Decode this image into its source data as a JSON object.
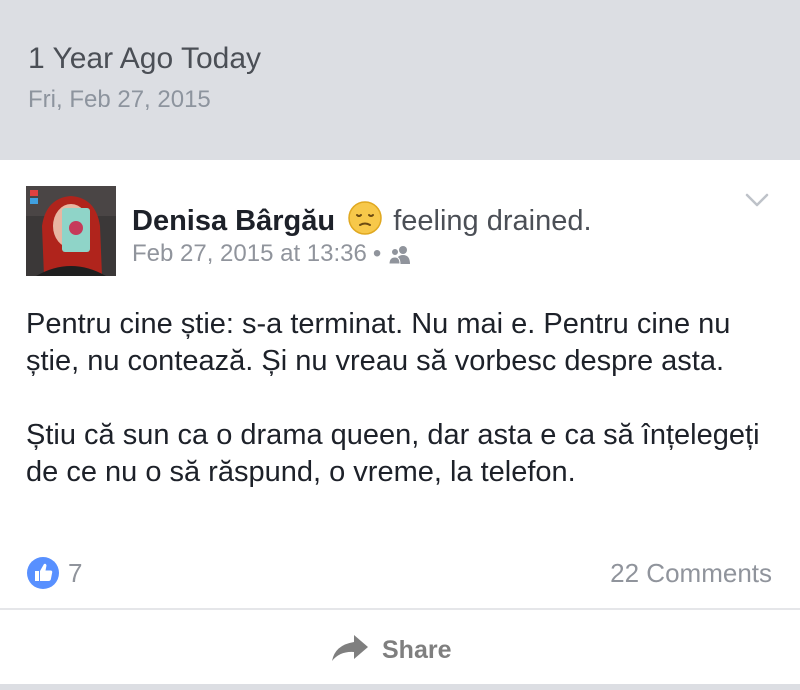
{
  "memory": {
    "title": "1 Year Ago Today",
    "date": "Fri, Feb 27, 2015"
  },
  "post": {
    "author": "Denisa Bârgău",
    "feeling": "feeling drained.",
    "feeling_icon": "sad-face-emoji-icon",
    "timestamp": "Feb 27, 2015 at 13:36",
    "separator": "•",
    "audience_icon": "friends-icon",
    "paragraphs": [
      "Pentru cine știe: s-a terminat. Nu mai e. Pentru cine nu știe, nu contează. Și nu vreau să vorbesc despre asta.",
      "Știu că sun ca o drama queen, dar asta e ca să înțelegeți de ce nu o să răspund,  o vreme, la telefon."
    ]
  },
  "stats": {
    "like_icon": "thumbs-up-icon",
    "likes": "7",
    "comments": "22 Comments"
  },
  "actions": {
    "share_icon": "share-arrow-icon",
    "share_label": "Share"
  },
  "colors": {
    "header_bg": "#dcdee3",
    "like_blue": "#5890ff",
    "text": "#1d2129",
    "muted": "#90949c"
  }
}
